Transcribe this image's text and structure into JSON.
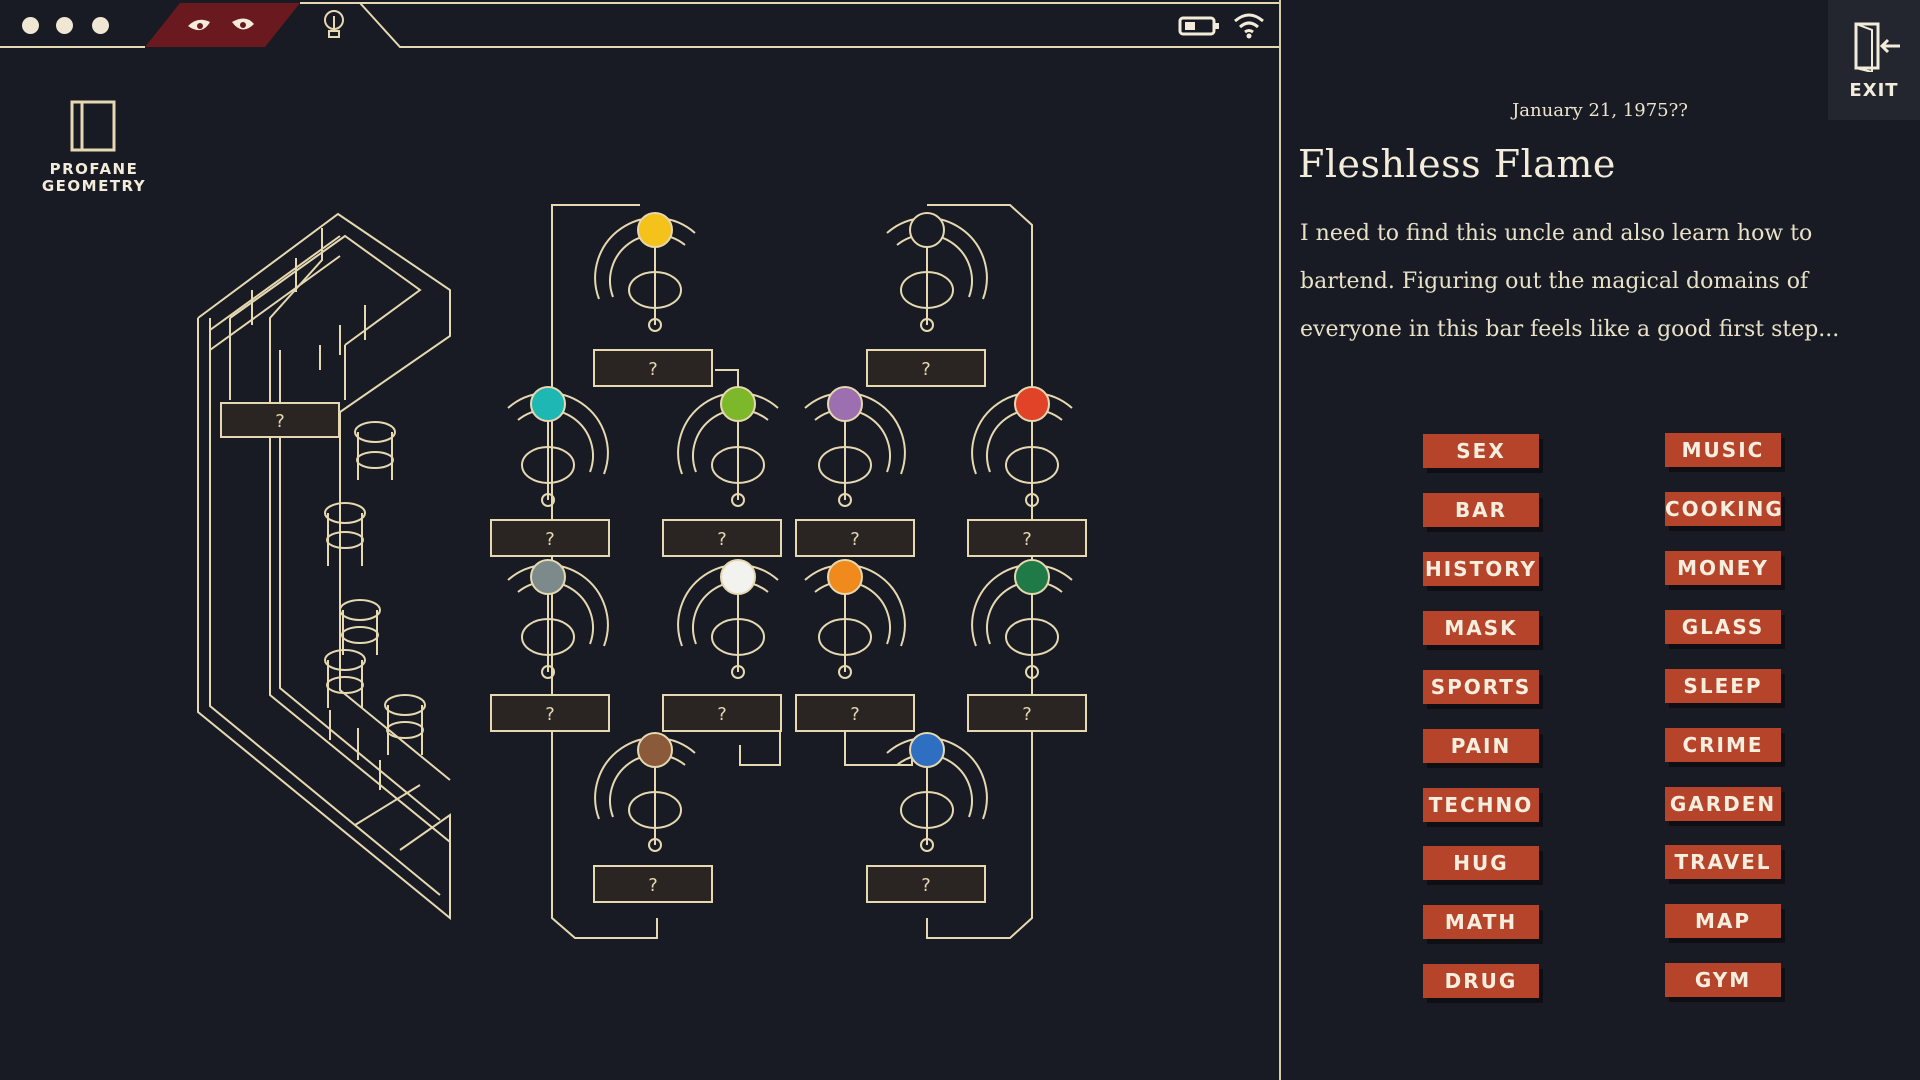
{
  "topbar": {
    "icons": [
      "window-dot",
      "window-dot",
      "window-dot",
      "eyes-icon",
      "lightbulb-icon",
      "battery-icon",
      "wifi-icon"
    ]
  },
  "sidebar": {
    "profane_label": "PROFANE\nGEOMETRY",
    "icon": "door-frame-icon"
  },
  "map": {
    "unknown_label": "?",
    "node_colors": {
      "yellow": "#f4c21a",
      "teal": "#1fb7b4",
      "lime": "#7cb82a",
      "purple": "#9c6fb0",
      "red": "#e14328",
      "gray": "#7c8a8c",
      "white": "#f2f2ee",
      "orange": "#f08a1c",
      "green": "#1f7a47",
      "brown": "#8a5a3a",
      "blue": "#2f6fc2",
      "empty": "#181b23"
    }
  },
  "panel": {
    "date": "January 21, 1975??",
    "title": "Fleshless Flame",
    "description": "I need to find this uncle and also learn how to bartend. Figuring out the magical domains of everyone in this bar feels like a good first step...",
    "exit_label": "EXIT"
  },
  "tags": {
    "left": [
      "SEX",
      "BAR",
      "HISTORY",
      "MASK",
      "SPORTS",
      "PAIN",
      "TECHNO",
      "HUG",
      "MATH",
      "DRUG"
    ],
    "right": [
      "MUSIC",
      "COOKING",
      "MONEY",
      "GLASS",
      "SLEEP",
      "CRIME",
      "GARDEN",
      "TRAVEL",
      "MAP",
      "GYM"
    ]
  },
  "colors": {
    "background": "#181b23",
    "accent": "#b6442a",
    "line": "#e6d8b0",
    "maroon": "#6a1a1f"
  }
}
